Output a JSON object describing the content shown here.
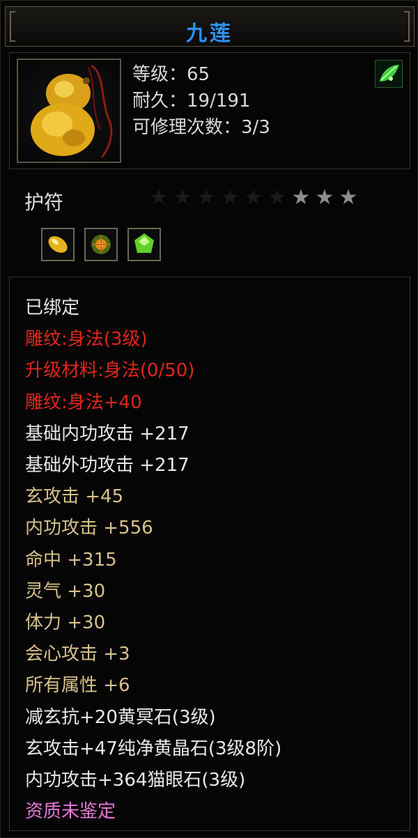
{
  "title": "九莲",
  "item": {
    "icon": "gourd-pendant-icon",
    "level_line": "等级：65",
    "durability_line": "耐久：19/191",
    "repair_line": "可修理次数：3/3",
    "badge_icon": "green-leaf-icon"
  },
  "item_type": "护符",
  "stars": {
    "total": 9,
    "lit": 3
  },
  "gems": [
    {
      "icon": "yellow-gem-icon"
    },
    {
      "icon": "orange-flower-gem-icon"
    },
    {
      "icon": "green-gem-icon"
    }
  ],
  "properties": [
    {
      "text": "已绑定",
      "color": "white"
    },
    {
      "text": "雕纹:身法(3级)",
      "color": "red"
    },
    {
      "text": "升级材料:身法(0/50)",
      "color": "red"
    },
    {
      "text": "雕纹:身法+40",
      "color": "red"
    },
    {
      "text": "基础内功攻击 +217",
      "color": "white"
    },
    {
      "text": "基础外功攻击 +217",
      "color": "white"
    },
    {
      "text": "玄攻击 +45",
      "color": "gold"
    },
    {
      "text": "内功攻击 +556",
      "color": "gold"
    },
    {
      "text": "命中 +315",
      "color": "gold"
    },
    {
      "text": "灵气 +30",
      "color": "gold"
    },
    {
      "text": "体力 +30",
      "color": "gold"
    },
    {
      "text": "会心攻击 +3",
      "color": "gold"
    },
    {
      "text": "所有属性 +6",
      "color": "gold"
    },
    {
      "text": "减玄抗+20黄冥石(3级)",
      "color": "white"
    },
    {
      "text": "玄攻击+47纯净黄晶石(3级8阶)",
      "color": "white"
    },
    {
      "text": "内功攻击+364猫眼石(3级)",
      "color": "white"
    },
    {
      "text": "资质未鉴定",
      "color": "pink"
    }
  ],
  "colors": {
    "title": "#2f8ff2",
    "white": "#e8e8e8",
    "red": "#e0261c",
    "gold": "#d8c28a",
    "pink": "#e57ad7"
  }
}
